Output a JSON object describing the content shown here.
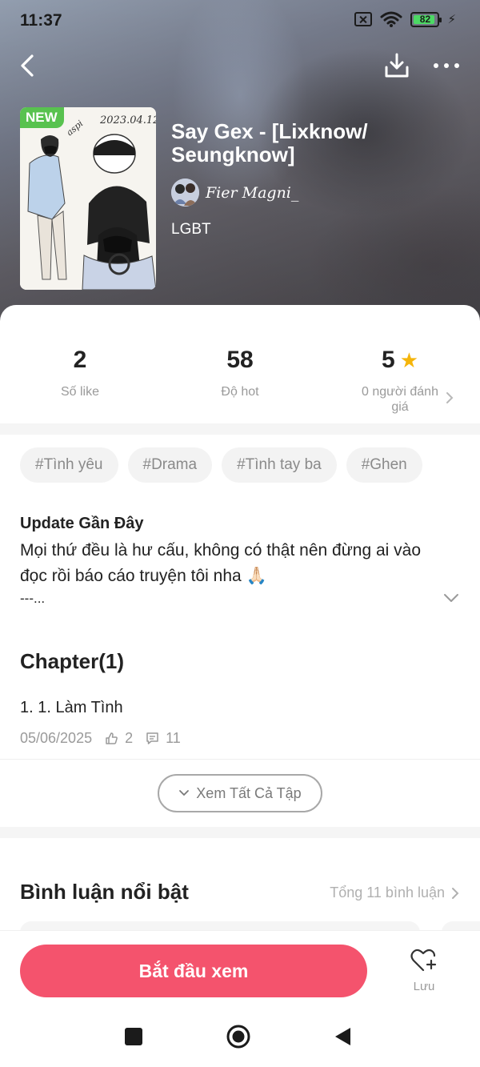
{
  "status_bar": {
    "time": "11:37",
    "battery_level": "82"
  },
  "story": {
    "badge": "NEW",
    "title": "Say Gex - [Lixknow/ Seungknow]",
    "author": "Fier Magni_",
    "genre": "LGBT"
  },
  "stats": [
    {
      "value": "2",
      "label": "Số like"
    },
    {
      "value": "58",
      "label": "Độ hot"
    },
    {
      "value": "5",
      "label": "0 người đánh giá"
    }
  ],
  "tags": [
    "#Tình yêu",
    "#Drama",
    "#Tình tay ba",
    "#Ghen"
  ],
  "update": {
    "heading": "Update Gần Đây",
    "body": "Mọi thứ đều là hư cấu, không có thật nên đừng ai vào đọc rồi báo cáo truyện tôi nha 🙏🏻",
    "more": "---..."
  },
  "chapters": {
    "heading": "Chapter(1)",
    "items": [
      {
        "name": "1. 1. Làm Tình",
        "date": "05/06/2025",
        "likes": "2",
        "comments": "11"
      }
    ],
    "see_all_label": "Xem Tất Cả Tập"
  },
  "comments": {
    "heading": "Bình luận nổi bật",
    "total_label": "Tổng 11 bình luận"
  },
  "actions": {
    "start_label": "Bắt đầu xem",
    "save_label": "Lưu"
  },
  "colors": {
    "accent": "#f4536d",
    "badge_green": "#58c24f",
    "star": "#f5b50a"
  },
  "icons": [
    "back-icon",
    "download-icon",
    "more-icon",
    "star-icon",
    "chevron-right-icon",
    "chevron-down-icon",
    "thumbs-up-icon",
    "comment-icon",
    "heart-plus-icon"
  ]
}
